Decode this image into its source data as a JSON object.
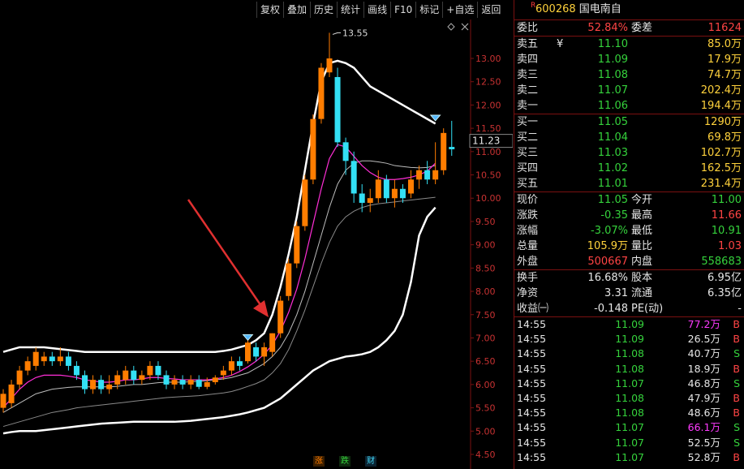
{
  "toolbar": {
    "buttons": [
      "复权",
      "叠加",
      "历史",
      "统计",
      "画线",
      "F10",
      "标记",
      "+自选",
      "返回"
    ]
  },
  "chart_data": {
    "type": "candlestick",
    "price_axis": {
      "min": 4.8,
      "max": 13.4,
      "ticks": [
        "13.00",
        "12.50",
        "12.00",
        "11.50",
        "11.00",
        "10.50",
        "10.00",
        "9.50",
        "9.00",
        "8.50",
        "8.00",
        "7.50",
        "7.00",
        "6.50",
        "6.00",
        "5.50",
        "5.00",
        "4.50"
      ]
    },
    "current_price_label": "11.23",
    "peak_label": "13.55",
    "candles": [
      {
        "o": 5.5,
        "c": 5.8,
        "h": 5.9,
        "l": 5.4
      },
      {
        "o": 5.6,
        "c": 6.0,
        "h": 6.1,
        "l": 5.5
      },
      {
        "o": 6.0,
        "c": 6.3,
        "h": 6.4,
        "l": 5.9
      },
      {
        "o": 6.3,
        "c": 6.5,
        "h": 6.6,
        "l": 6.2
      },
      {
        "o": 6.4,
        "c": 6.7,
        "h": 6.8,
        "l": 6.3
      },
      {
        "o": 6.5,
        "c": 6.6,
        "h": 6.7,
        "l": 6.4
      },
      {
        "o": 6.6,
        "c": 6.5,
        "h": 6.7,
        "l": 6.4
      },
      {
        "o": 6.5,
        "c": 6.6,
        "h": 6.8,
        "l": 6.4
      },
      {
        "o": 6.6,
        "c": 6.4,
        "h": 6.7,
        "l": 6.3
      },
      {
        "o": 6.4,
        "c": 6.2,
        "h": 6.5,
        "l": 6.1
      },
      {
        "o": 6.2,
        "c": 5.9,
        "h": 6.3,
        "l": 5.8
      },
      {
        "o": 5.9,
        "c": 6.1,
        "h": 6.2,
        "l": 5.8
      },
      {
        "o": 6.1,
        "c": 5.9,
        "h": 6.2,
        "l": 5.8
      },
      {
        "o": 5.9,
        "c": 6.0,
        "h": 6.2,
        "l": 5.8
      },
      {
        "o": 6.0,
        "c": 6.2,
        "h": 6.3,
        "l": 5.9
      },
      {
        "o": 6.1,
        "c": 6.3,
        "h": 6.4,
        "l": 6.0
      },
      {
        "o": 6.3,
        "c": 6.1,
        "h": 6.4,
        "l": 6.0
      },
      {
        "o": 6.1,
        "c": 6.2,
        "h": 6.3,
        "l": 6.0
      },
      {
        "o": 6.2,
        "c": 6.4,
        "h": 6.5,
        "l": 6.1
      },
      {
        "o": 6.4,
        "c": 6.2,
        "h": 6.5,
        "l": 6.1
      },
      {
        "o": 6.2,
        "c": 6.0,
        "h": 6.3,
        "l": 5.9
      },
      {
        "o": 6.0,
        "c": 6.1,
        "h": 6.2,
        "l": 5.9
      },
      {
        "o": 6.1,
        "c": 6.0,
        "h": 6.2,
        "l": 5.9
      },
      {
        "o": 6.0,
        "c": 6.1,
        "h": 6.2,
        "l": 5.9
      },
      {
        "o": 6.1,
        "c": 5.95,
        "h": 6.2,
        "l": 5.9
      },
      {
        "o": 5.95,
        "c": 6.05,
        "h": 6.15,
        "l": 5.9
      },
      {
        "o": 6.05,
        "c": 6.15,
        "h": 6.2,
        "l": 6.0
      },
      {
        "o": 6.2,
        "c": 6.3,
        "h": 6.4,
        "l": 6.1
      },
      {
        "o": 6.3,
        "c": 6.5,
        "h": 6.6,
        "l": 6.2
      },
      {
        "o": 6.5,
        "c": 6.4,
        "h": 6.6,
        "l": 6.3
      },
      {
        "o": 6.5,
        "c": 6.9,
        "h": 6.95,
        "l": 6.45
      },
      {
        "o": 6.8,
        "c": 6.6,
        "h": 6.9,
        "l": 6.5
      },
      {
        "o": 6.6,
        "c": 6.8,
        "h": 6.9,
        "l": 6.4
      },
      {
        "o": 6.7,
        "c": 7.1,
        "h": 7.1,
        "l": 6.6
      },
      {
        "o": 7.1,
        "c": 7.8,
        "h": 7.9,
        "l": 7.0
      },
      {
        "o": 7.9,
        "c": 8.6,
        "h": 8.7,
        "l": 7.8
      },
      {
        "o": 8.6,
        "c": 9.4,
        "h": 9.5,
        "l": 8.5
      },
      {
        "o": 9.4,
        "c": 10.4,
        "h": 10.5,
        "l": 9.3
      },
      {
        "o": 10.4,
        "c": 11.7,
        "h": 11.8,
        "l": 10.3
      },
      {
        "o": 11.7,
        "c": 12.8,
        "h": 12.9,
        "l": 11.6
      },
      {
        "o": 12.7,
        "c": 13.0,
        "h": 13.55,
        "l": 12.6
      },
      {
        "o": 12.6,
        "c": 11.2,
        "h": 12.8,
        "l": 11.1
      },
      {
        "o": 11.2,
        "c": 10.8,
        "h": 11.3,
        "l": 10.5
      },
      {
        "o": 10.8,
        "c": 10.1,
        "h": 11.0,
        "l": 9.9
      },
      {
        "o": 10.1,
        "c": 9.9,
        "h": 10.3,
        "l": 9.7
      },
      {
        "o": 9.9,
        "c": 10.0,
        "h": 10.2,
        "l": 9.7
      },
      {
        "o": 10.0,
        "c": 10.4,
        "h": 10.6,
        "l": 9.9
      },
      {
        "o": 10.4,
        "c": 10.0,
        "h": 10.5,
        "l": 9.9
      },
      {
        "o": 10.0,
        "c": 10.2,
        "h": 10.4,
        "l": 9.8
      },
      {
        "o": 10.2,
        "c": 10.0,
        "h": 10.3,
        "l": 9.9
      },
      {
        "o": 10.1,
        "c": 10.4,
        "h": 10.6,
        "l": 10.0
      },
      {
        "o": 10.4,
        "c": 10.6,
        "h": 10.7,
        "l": 10.2
      },
      {
        "o": 10.6,
        "c": 10.4,
        "h": 10.8,
        "l": 10.3
      },
      {
        "o": 10.4,
        "c": 10.6,
        "h": 11.2,
        "l": 10.3
      },
      {
        "o": 10.6,
        "c": 11.4,
        "h": 11.5,
        "l": 10.5
      },
      {
        "o": 11.1,
        "c": 11.05,
        "h": 11.66,
        "l": 10.91
      }
    ],
    "ma_white": [
      6.7,
      6.75,
      6.8,
      6.8,
      6.8,
      6.8,
      6.78,
      6.76,
      6.74,
      6.72,
      6.7,
      6.7,
      6.7,
      6.7,
      6.7,
      6.7,
      6.7,
      6.7,
      6.7,
      6.7,
      6.7,
      6.7,
      6.7,
      6.7,
      6.7,
      6.7,
      6.7,
      6.72,
      6.75,
      6.8,
      6.85,
      6.95,
      7.1,
      7.5,
      8.1,
      8.8,
      9.6,
      10.6,
      11.6,
      12.5,
      12.9,
      12.95,
      12.9,
      12.8,
      12.6,
      12.4,
      12.3,
      12.2,
      12.1,
      12.0,
      11.9,
      11.8,
      11.7,
      11.6
    ],
    "ma_magenta": [
      5.5,
      5.7,
      5.9,
      6.05,
      6.15,
      6.2,
      6.2,
      6.2,
      6.18,
      6.15,
      6.1,
      6.08,
      6.05,
      6.05,
      6.07,
      6.1,
      6.1,
      6.12,
      6.15,
      6.15,
      6.13,
      6.12,
      6.1,
      6.1,
      6.1,
      6.1,
      6.12,
      6.15,
      6.2,
      6.28,
      6.38,
      6.5,
      6.65,
      6.85,
      7.15,
      7.55,
      8.05,
      8.7,
      9.45,
      10.2,
      10.85,
      11.15,
      11.1,
      10.9,
      10.7,
      10.55,
      10.45,
      10.4,
      10.4,
      10.42,
      10.45,
      10.5,
      10.58,
      10.75
    ],
    "ma_inner_gray": [
      5.4,
      5.5,
      5.6,
      5.7,
      5.8,
      5.85,
      5.9,
      5.92,
      5.94,
      5.95,
      5.95,
      5.95,
      5.95,
      5.95,
      5.96,
      5.98,
      6.0,
      6.0,
      6.02,
      6.04,
      6.05,
      6.05,
      6.05,
      6.06,
      6.07,
      6.08,
      6.1,
      6.12,
      6.15,
      6.2,
      6.25,
      6.35,
      6.45,
      6.6,
      6.8,
      7.1,
      7.5,
      8.0,
      8.6,
      9.2,
      9.8,
      10.3,
      10.6,
      10.75,
      10.8,
      10.8,
      10.78,
      10.75,
      10.7,
      10.68,
      10.66,
      10.65,
      10.66,
      10.7
    ],
    "ma_outer_gray": [
      5.1,
      5.15,
      5.2,
      5.25,
      5.3,
      5.35,
      5.4,
      5.43,
      5.46,
      5.5,
      5.52,
      5.54,
      5.56,
      5.58,
      5.6,
      5.62,
      5.64,
      5.66,
      5.68,
      5.7,
      5.72,
      5.73,
      5.74,
      5.75,
      5.76,
      5.78,
      5.8,
      5.82,
      5.85,
      5.9,
      5.96,
      6.02,
      6.1,
      6.25,
      6.45,
      6.75,
      7.15,
      7.6,
      8.1,
      8.6,
      9.05,
      9.4,
      9.6,
      9.72,
      9.8,
      9.85,
      9.88,
      9.9,
      9.92,
      9.94,
      9.96,
      9.98,
      10.0,
      10.02
    ],
    "ma_lower": [
      4.95,
      4.98,
      5.0,
      5.0,
      5.0,
      5.02,
      5.04,
      5.06,
      5.08,
      5.1,
      5.12,
      5.14,
      5.16,
      5.17,
      5.18,
      5.19,
      5.2,
      5.2,
      5.2,
      5.2,
      5.2,
      5.2,
      5.21,
      5.22,
      5.24,
      5.26,
      5.28,
      5.3,
      5.33,
      5.36,
      5.4,
      5.45,
      5.5,
      5.6,
      5.7,
      5.85,
      6.0,
      6.15,
      6.3,
      6.4,
      6.5,
      6.55,
      6.6,
      6.62,
      6.65,
      6.7,
      6.8,
      6.95,
      7.15,
      7.5,
      8.2,
      9.2,
      9.6,
      9.8
    ],
    "bottom_tags": [
      "涨",
      "跌",
      "财"
    ]
  },
  "quote_panel": {
    "title": {
      "badge": "R",
      "code": "600268",
      "name": "国电南自"
    },
    "ratio": {
      "label1": "委比",
      "value1": "52.84%",
      "label2": "委差",
      "value2": "11624"
    },
    "asks": [
      {
        "label": "卖五",
        "extra": "¥",
        "price": "11.10",
        "vol": "85.0万"
      },
      {
        "label": "卖四",
        "extra": "",
        "price": "11.09",
        "vol": "17.9万"
      },
      {
        "label": "卖三",
        "extra": "",
        "price": "11.08",
        "vol": "74.7万"
      },
      {
        "label": "卖二",
        "extra": "",
        "price": "11.07",
        "vol": "202.4万"
      },
      {
        "label": "卖一",
        "extra": "",
        "price": "11.06",
        "vol": "194.4万"
      }
    ],
    "bids": [
      {
        "label": "买一",
        "price": "11.05",
        "vol": "1290万"
      },
      {
        "label": "买二",
        "price": "11.04",
        "vol": "69.8万"
      },
      {
        "label": "买三",
        "price": "11.03",
        "vol": "102.7万"
      },
      {
        "label": "买四",
        "price": "11.02",
        "vol": "162.5万"
      },
      {
        "label": "买五",
        "price": "11.01",
        "vol": "231.4万"
      }
    ],
    "stats": [
      {
        "l1": "现价",
        "v1": "11.05",
        "c1": "green",
        "l2": "今开",
        "v2": "11.00",
        "c2": "green"
      },
      {
        "l1": "涨跌",
        "v1": "-0.35",
        "c1": "green",
        "l2": "最高",
        "v2": "11.66",
        "c2": "red"
      },
      {
        "l1": "涨幅",
        "v1": "-3.07%",
        "c1": "green",
        "l2": "最低",
        "v2": "10.91",
        "c2": "green"
      },
      {
        "l1": "总量",
        "v1": "105.9万",
        "c1": "yellow",
        "l2": "量比",
        "v2": "1.03",
        "c2": "red"
      },
      {
        "l1": "外盘",
        "v1": "500667",
        "c1": "red",
        "l2": "内盘",
        "v2": "558683",
        "c2": "green"
      }
    ],
    "fund": [
      {
        "l1": "换手",
        "v1": "16.68%",
        "l2": "股本",
        "v2": "6.95亿"
      },
      {
        "l1": "净资",
        "v1": "3.31",
        "l2": "流通",
        "v2": "6.35亿"
      },
      {
        "l1": "收益㈠",
        "v1": "-0.148",
        "l2": "PE(动)",
        "v2": "-"
      }
    ],
    "ticks": [
      {
        "time": "14:55",
        "price": "11.09",
        "vol": "77.2万",
        "side": "B",
        "pc": "green",
        "vc": "magenta"
      },
      {
        "time": "14:55",
        "price": "11.09",
        "vol": "26.5万",
        "side": "B",
        "pc": "green",
        "vc": "white"
      },
      {
        "time": "14:55",
        "price": "11.08",
        "vol": "40.7万",
        "side": "S",
        "pc": "green",
        "vc": "white"
      },
      {
        "time": "14:55",
        "price": "11.08",
        "vol": "18.9万",
        "side": "B",
        "pc": "green",
        "vc": "white"
      },
      {
        "time": "14:55",
        "price": "11.07",
        "vol": "46.8万",
        "side": "S",
        "pc": "green",
        "vc": "white"
      },
      {
        "time": "14:55",
        "price": "11.08",
        "vol": "47.9万",
        "side": "B",
        "pc": "green",
        "vc": "white"
      },
      {
        "time": "14:55",
        "price": "11.08",
        "vol": "48.6万",
        "side": "B",
        "pc": "green",
        "vc": "white"
      },
      {
        "time": "14:55",
        "price": "11.07",
        "vol": "66.1万",
        "side": "S",
        "pc": "green",
        "vc": "magenta"
      },
      {
        "time": "14:55",
        "price": "11.07",
        "vol": "52.5万",
        "side": "S",
        "pc": "green",
        "vc": "white"
      },
      {
        "time": "14:55",
        "price": "11.07",
        "vol": "52.8万",
        "side": "B",
        "pc": "green",
        "vc": "white"
      }
    ]
  },
  "colors": {
    "up": "#ff7d00",
    "down": "#33e0f5",
    "white_line": "#ffffff",
    "magenta_line": "#ff2ed6",
    "gray_line": "#8a8a8a",
    "border": "#7a1010",
    "arrow": "#e03030"
  }
}
